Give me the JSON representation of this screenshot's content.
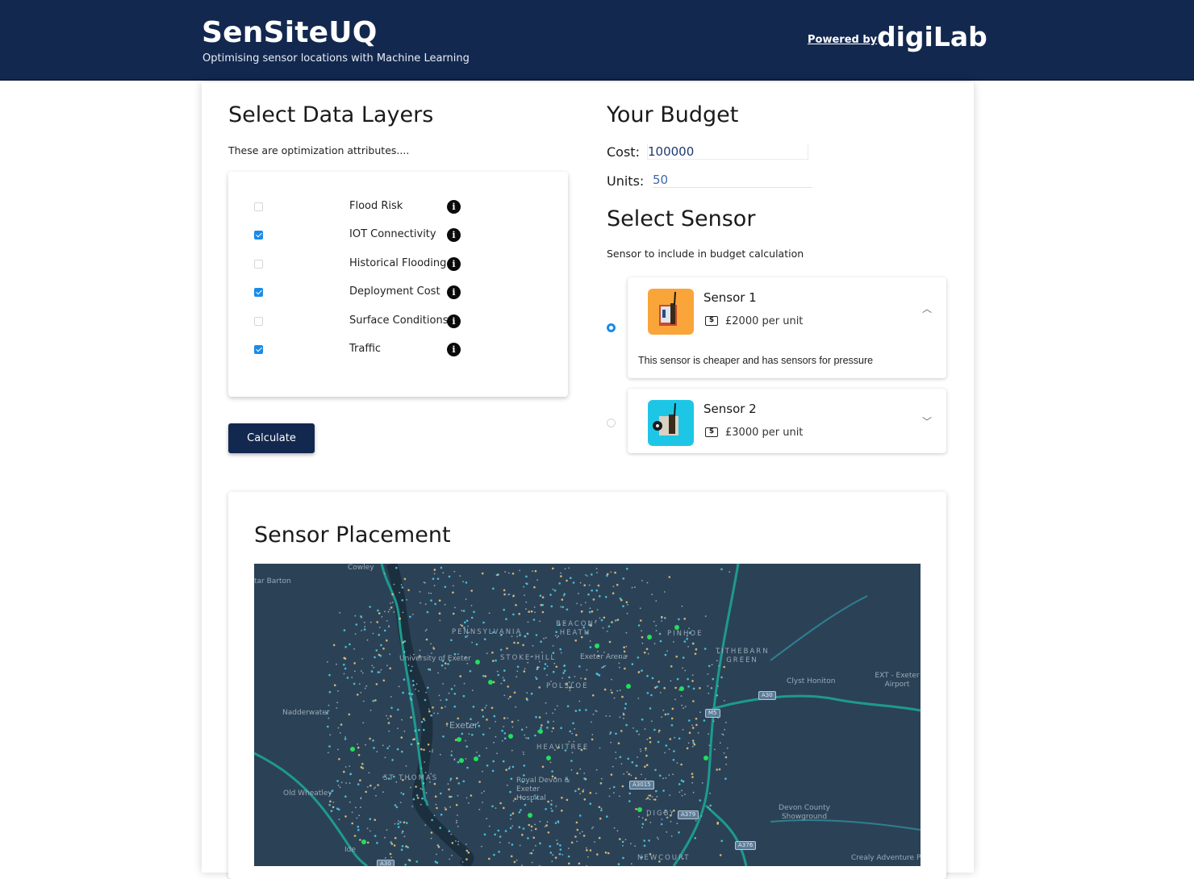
{
  "header": {
    "title": "SenSiteUQ",
    "subtitle": "Optimising sensor locations with Machine Learning",
    "powered_by": "Powered by",
    "partner_logo": "digiLab",
    "background_color": "#13284f"
  },
  "data_layers": {
    "heading": "Select Data Layers",
    "description": "These are optimization attributes....",
    "items": [
      {
        "label": "Flood Risk",
        "checked": false,
        "icon": "info-icon"
      },
      {
        "label": "IOT Connectivity",
        "checked": true,
        "icon": "info-icon"
      },
      {
        "label": "Historical Flooding",
        "checked": false,
        "icon": "info-icon"
      },
      {
        "label": "Deployment Cost",
        "checked": true,
        "icon": "info-icon"
      },
      {
        "label": "Surface Conditions",
        "checked": false,
        "icon": "info-icon"
      },
      {
        "label": "Traffic",
        "checked": true,
        "icon": "info-icon"
      }
    ],
    "calculate_label": "Calculate"
  },
  "budget": {
    "heading": "Your Budget",
    "cost_label": "Cost:",
    "cost_value": "100000",
    "units_label": "Units:",
    "units_value": "50"
  },
  "sensor_select": {
    "heading": "Select Sensor",
    "description": "Sensor to include in budget calculation",
    "sensors": [
      {
        "name": "Sensor 1",
        "price": "£2000 per unit",
        "selected": true,
        "expanded": true,
        "description": "This sensor is cheaper and has sensors for pressure",
        "thumb_color": "#f9a53a",
        "price_icon": "dollar-bill-icon",
        "chevron": "chevron-up-icon"
      },
      {
        "name": "Sensor 2",
        "price": "£3000 per unit",
        "selected": false,
        "expanded": false,
        "thumb_color": "#1ec6e6",
        "price_icon": "dollar-bill-icon",
        "chevron": "chevron-down-icon"
      }
    ]
  },
  "placement": {
    "heading": "Sensor Placement",
    "map": {
      "place_labels": [
        "Cowley",
        "tar Barton",
        "PENNSYLVANIA",
        "University of Exeter",
        "BEACON HEATH",
        "STOKE HILL",
        "Exeter Arena",
        "PINHOE",
        "TITHEBARN GREEN",
        "Clyst Honiton",
        "EXT - Exeter Airport",
        "Nadderwater",
        "Exeter",
        "POLSLOE",
        "HEAVITREE",
        "ST THOMAS",
        "Royal Devon & Exeter Hospital",
        "Old Wheatley",
        "DIGBY",
        "Devon County Showground",
        "Ide",
        "NEWCOURT",
        "Crealy Adventure Pa"
      ],
      "road_labels": [
        "A30",
        "M5",
        "A3015",
        "A379",
        "A376",
        "A30"
      ],
      "colors": {
        "background": "#2b4256",
        "major_road": "#1d9a8e",
        "sensor_marker": "#22e05a",
        "point_cyan": "#4fd2ee",
        "point_amber": "#f2c879"
      }
    }
  }
}
